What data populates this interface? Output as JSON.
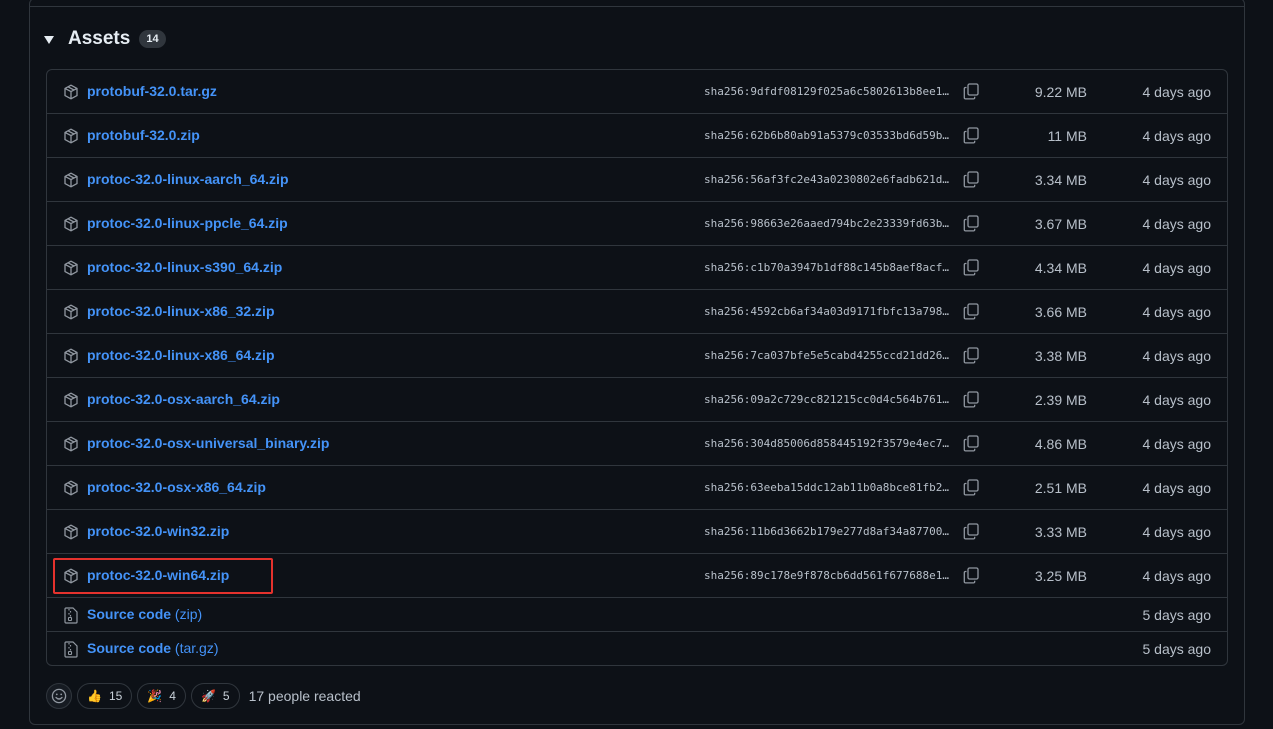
{
  "assets": {
    "title": "Assets",
    "count": "14",
    "files": [
      {
        "name": "protobuf-32.0.tar.gz",
        "sha": "sha256:9dfdf08129f025a6c5802613b8ee1…",
        "size": "9.22 MB",
        "date": "4 days ago"
      },
      {
        "name": "protobuf-32.0.zip",
        "sha": "sha256:62b6b80ab91a5379c03533bd6d59b…",
        "size": "11 MB",
        "date": "4 days ago"
      },
      {
        "name": "protoc-32.0-linux-aarch_64.zip",
        "sha": "sha256:56af3fc2e43a0230802e6fadb621d…",
        "size": "3.34 MB",
        "date": "4 days ago"
      },
      {
        "name": "protoc-32.0-linux-ppcle_64.zip",
        "sha": "sha256:98663e26aaed794bc2e23339fd63b…",
        "size": "3.67 MB",
        "date": "4 days ago"
      },
      {
        "name": "protoc-32.0-linux-s390_64.zip",
        "sha": "sha256:c1b70a3947b1df88c145b8aef8acf…",
        "size": "4.34 MB",
        "date": "4 days ago"
      },
      {
        "name": "protoc-32.0-linux-x86_32.zip",
        "sha": "sha256:4592cb6af34a03d9171fbfc13a798…",
        "size": "3.66 MB",
        "date": "4 days ago"
      },
      {
        "name": "protoc-32.0-linux-x86_64.zip",
        "sha": "sha256:7ca037bfe5e5cabd4255ccd21dd26…",
        "size": "3.38 MB",
        "date": "4 days ago"
      },
      {
        "name": "protoc-32.0-osx-aarch_64.zip",
        "sha": "sha256:09a2c729cc821215cc0d4c564b761…",
        "size": "2.39 MB",
        "date": "4 days ago"
      },
      {
        "name": "protoc-32.0-osx-universal_binary.zip",
        "sha": "sha256:304d85006d858445192f3579e4ec7…",
        "size": "4.86 MB",
        "date": "4 days ago"
      },
      {
        "name": "protoc-32.0-osx-x86_64.zip",
        "sha": "sha256:63eeba15ddc12ab11b0a8bce81fb2…",
        "size": "2.51 MB",
        "date": "4 days ago"
      },
      {
        "name": "protoc-32.0-win32.zip",
        "sha": "sha256:11b6d3662b179e277d8af34a87700…",
        "size": "3.33 MB",
        "date": "4 days ago"
      },
      {
        "name": "protoc-32.0-win64.zip",
        "sha": "sha256:89c178e9f878cb6dd561f677688e1…",
        "size": "3.25 MB",
        "date": "4 days ago"
      }
    ],
    "source": [
      {
        "label": "Source code",
        "suffix": "(zip)",
        "date": "5 days ago"
      },
      {
        "label": "Source code",
        "suffix": "(tar.gz)",
        "date": "5 days ago"
      }
    ]
  },
  "reactions": {
    "items": [
      {
        "emoji": "👍",
        "count": "15"
      },
      {
        "emoji": "🎉",
        "count": "4"
      },
      {
        "emoji": "🚀",
        "count": "5"
      }
    ],
    "summary": "17 people reacted"
  },
  "highlight_color": "#e5322d",
  "link_color": "#4493f8"
}
